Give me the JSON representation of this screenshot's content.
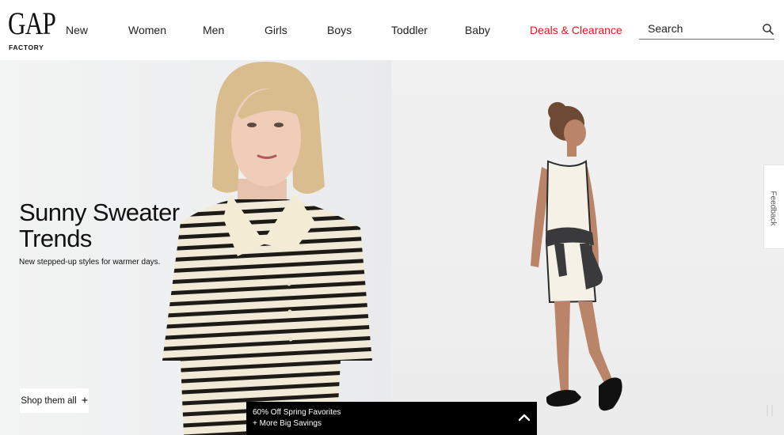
{
  "brand": {
    "logo_text": "GAP",
    "logo_sub": "FACTORY"
  },
  "nav": {
    "items": [
      {
        "label": "New"
      },
      {
        "label": "Women"
      },
      {
        "label": "Men"
      },
      {
        "label": "Girls"
      },
      {
        "label": "Boys"
      },
      {
        "label": "Toddler"
      },
      {
        "label": "Baby"
      },
      {
        "label": "Deals & Clearance"
      }
    ],
    "deals_color": "#e4161c"
  },
  "search": {
    "placeholder": "Search",
    "icon": "search-icon"
  },
  "hero": {
    "title": "Sunny Sweater\nTrends",
    "subtitle": "New stepped-up styles for warmer days.",
    "cta_label": "Shop them all",
    "cta_icon": "plus-icon"
  },
  "feedback": {
    "label": "Feedback"
  },
  "promo": {
    "line1": "60% Off Spring Favorites",
    "line2": "+ More Big Savings",
    "icon": "chevron-up-icon"
  },
  "carousel": {
    "pause_icon": "pause-icon"
  }
}
